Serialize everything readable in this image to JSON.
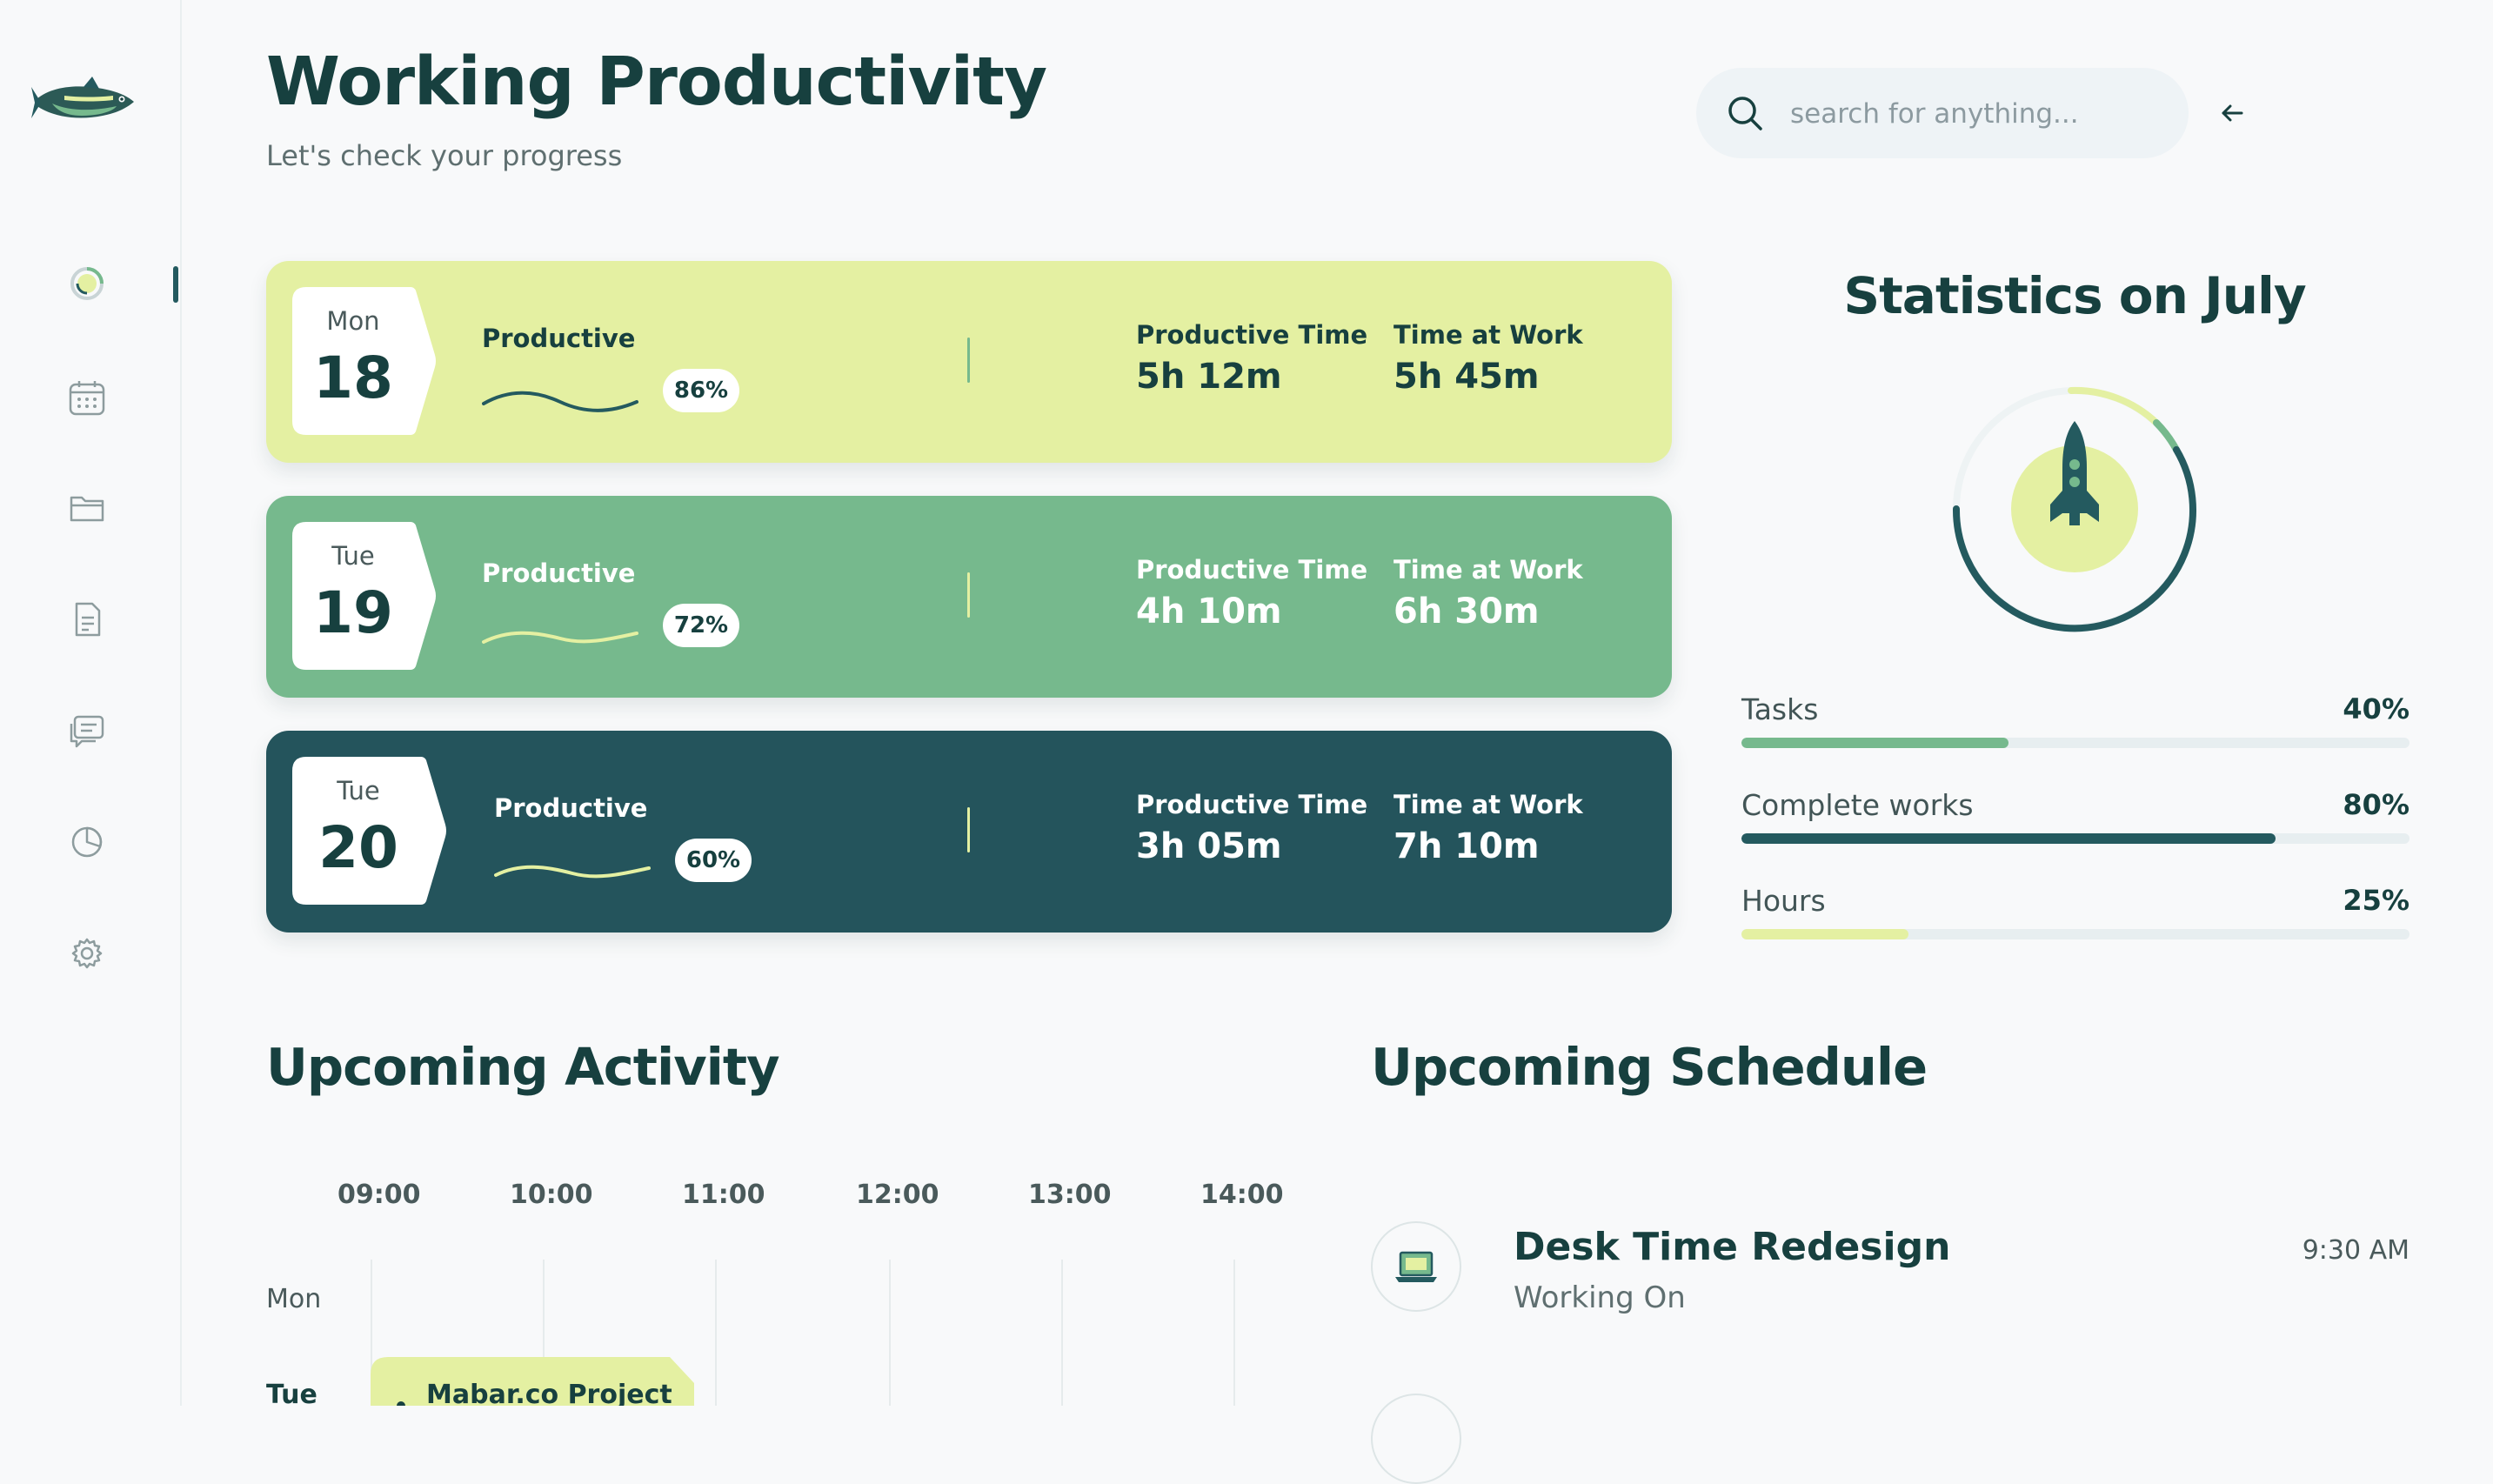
{
  "app": {
    "title": "Working Productivity",
    "subtitle": "Let's check your progress"
  },
  "search": {
    "placeholder": "search for anything..."
  },
  "sidebar": {
    "items": [
      {
        "icon": "dashboard-icon",
        "active": true
      },
      {
        "icon": "calendar-icon"
      },
      {
        "icon": "folder-icon"
      },
      {
        "icon": "document-icon"
      },
      {
        "icon": "messages-icon"
      },
      {
        "icon": "reports-icon"
      },
      {
        "icon": "settings-icon"
      }
    ]
  },
  "days": [
    {
      "dow": "Mon",
      "date": "18",
      "label": "Productive",
      "percent": "86%",
      "productive_time_label": "Productive Time",
      "productive_time": "5h 12m",
      "time_at_work_label": "Time at Work",
      "time_at_work": "5h 45m",
      "bg": "#e4f0a2",
      "text": "#17403f",
      "wave": "#245a5f"
    },
    {
      "dow": "Tue",
      "date": "19",
      "label": "Productive",
      "percent": "72%",
      "productive_time_label": "Productive Time",
      "productive_time": "4h 10m",
      "time_at_work_label": "Time at Work",
      "time_at_work": "6h 30m",
      "bg": "#76b98d",
      "text": "#ffffff",
      "wave": "#e4f0a2"
    },
    {
      "dow": "Tue",
      "date": "20",
      "label": "Productive",
      "percent": "60%",
      "productive_time_label": "Productive Time",
      "productive_time": "3h 05m",
      "time_at_work_label": "Time at Work",
      "time_at_work": "7h 10m",
      "bg": "#24545c",
      "text": "#ffffff",
      "wave": "#e4f0a2"
    }
  ],
  "statistics": {
    "title": "Statistics on July",
    "items": [
      {
        "label": "Tasks",
        "value": "40%",
        "fraction": 0.4,
        "color": "#76b98d"
      },
      {
        "label": "Complete works",
        "value": "80%",
        "fraction": 0.8,
        "color": "#245a5f"
      },
      {
        "label": "Hours",
        "value": "25%",
        "fraction": 0.25,
        "color": "#e4f0a2"
      }
    ]
  },
  "activity": {
    "title": "Upcoming Activity",
    "times": [
      "09:00",
      "10:00",
      "11:00",
      "12:00",
      "13:00",
      "14:00"
    ],
    "days": [
      "Mon",
      "Tue"
    ],
    "event": {
      "label": "Mabar.co Project",
      "color": "#e4f0a2"
    }
  },
  "schedule": {
    "title": "Upcoming Schedule",
    "items": [
      {
        "title": "Desk Time Redesign",
        "subtitle": "Working On",
        "time": "9:30 AM",
        "icon": "laptop-icon"
      }
    ]
  },
  "colors": {
    "primary": "#17403f",
    "teal": "#245a5f",
    "green": "#76b98d",
    "lime": "#e4f0a2"
  }
}
